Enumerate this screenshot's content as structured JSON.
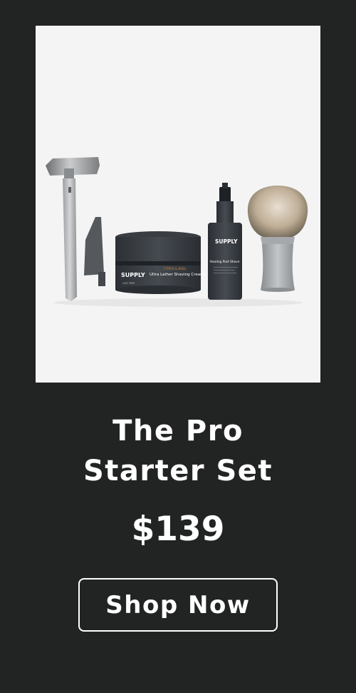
{
  "product": {
    "image_alt": "Razor, blade tool, shaving cream jar, post shave spray bottle and shaving brush",
    "title_line1": "The Pro",
    "title_line2": "Starter Set",
    "price": "$139",
    "cta_label": "Shop Now",
    "jar_label_brand": "SUPPLY",
    "jar_label_sub": "LIVE FREE",
    "jar_label_accent": "CITRUS & BASIL",
    "jar_label_name": "Ultra Lather Shaving Cream",
    "spray_label_brand": "SUPPLY",
    "spray_label_name": "Healing Post Shave"
  },
  "colors": {
    "background": "#222423",
    "image_background": "#f4f4f4",
    "text": "#ffffff",
    "accent_orange": "#c9813c"
  }
}
